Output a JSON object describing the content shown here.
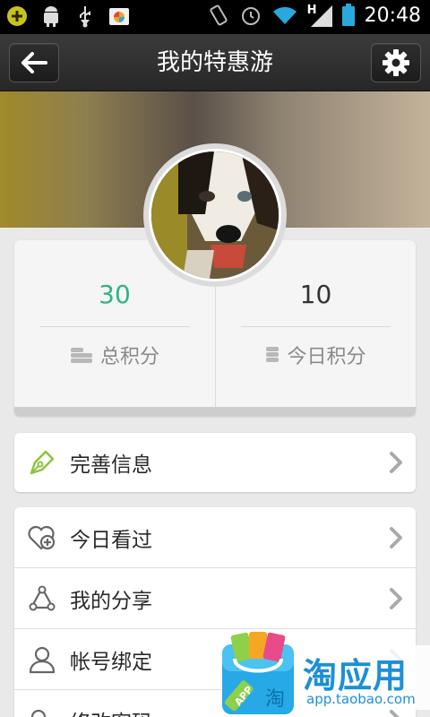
{
  "status_bar": {
    "time": "20:48",
    "network": "H",
    "icons": [
      "add-icon",
      "android-debug-icon",
      "usb-icon",
      "app-icon",
      "vibrate-icon",
      "alarm-icon",
      "wifi-icon",
      "signal-icon",
      "battery-icon"
    ]
  },
  "title_bar": {
    "title": "我的特惠游",
    "back_icon": "back-arrow-icon",
    "settings_icon": "gear-icon"
  },
  "stats": {
    "total_points": "30",
    "total_points_label": "总积分",
    "today_points": "10",
    "today_points_label": "今日积分",
    "accent_color": "#2fb38a"
  },
  "menu": {
    "profile": {
      "label": "完善信息",
      "icon": "pen-icon"
    },
    "items": [
      {
        "label": "今日看过",
        "icon": "heart-plus-icon"
      },
      {
        "label": "我的分享",
        "icon": "share-icon"
      },
      {
        "label": "帐号绑定",
        "icon": "user-icon"
      },
      {
        "label": "修改密码",
        "icon": "key-icon"
      }
    ]
  },
  "watermark": {
    "brand": "淘应用",
    "url": "app.taobao.com",
    "app_badge": "APP",
    "bag_char": "淘"
  }
}
